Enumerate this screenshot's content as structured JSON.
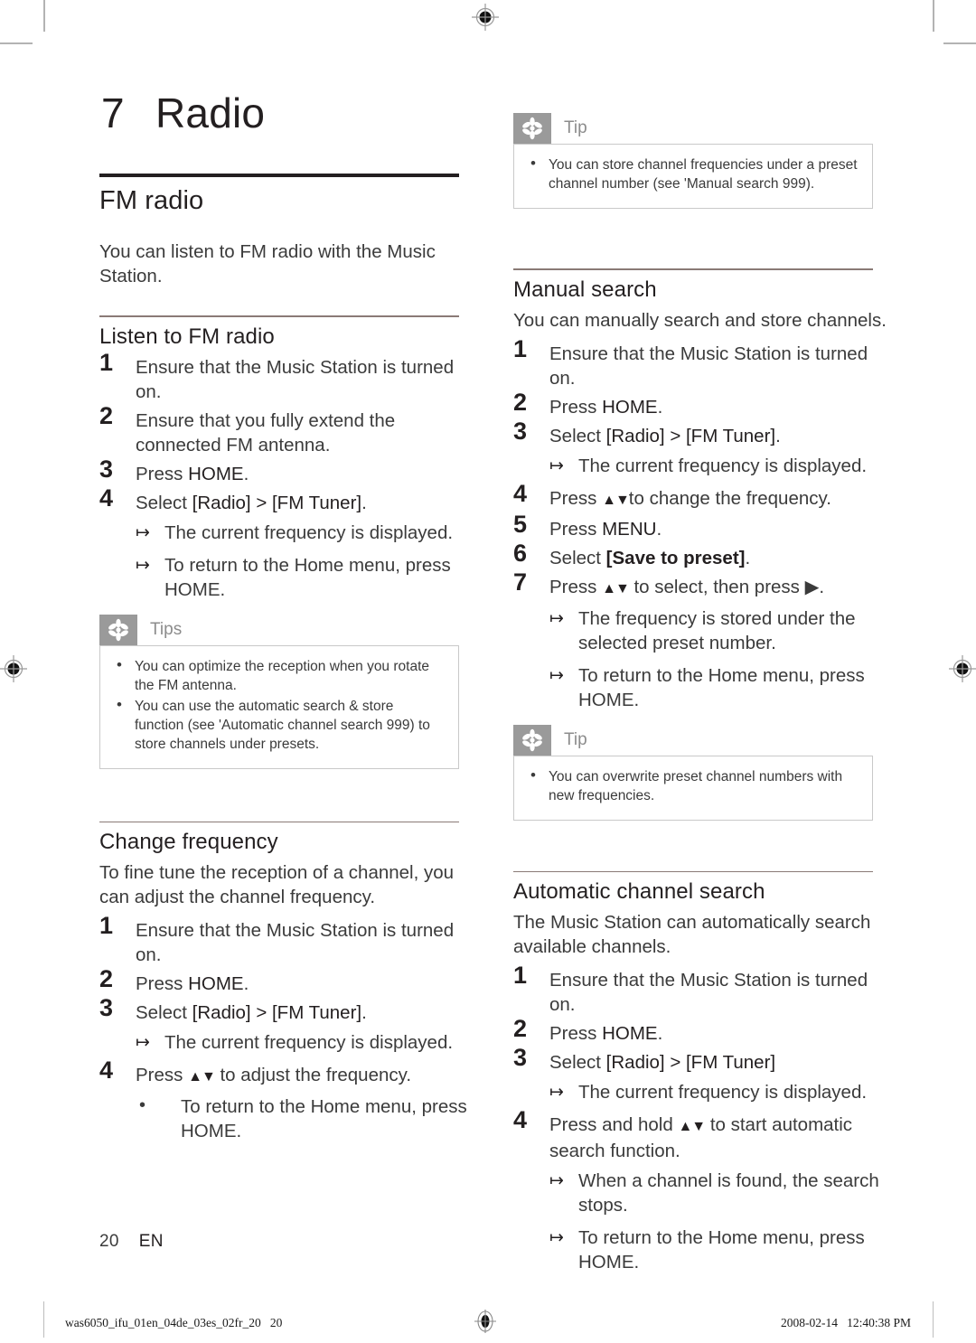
{
  "chapter": {
    "number": "7",
    "title": "Radio"
  },
  "section": {
    "title": "FM radio",
    "intro": "You can listen to FM radio with the Music Station."
  },
  "left_column": {
    "listen": {
      "heading": "Listen to FM radio",
      "steps": [
        {
          "text": "Ensure that the Music Station is turned on."
        },
        {
          "text": "Ensure that you fully extend the connected FM antenna."
        },
        {
          "text_pre": "Press ",
          "keyword": "HOME",
          "text_post": "."
        },
        {
          "text_pre": "Select ",
          "keyword": "[Radio] > [FM Tuner]",
          "text_post": ".",
          "results": [
            "The current frequency is displayed.",
            "To return to the Home menu, press HOME."
          ]
        }
      ]
    },
    "tips_box": {
      "label": "Tips",
      "icon": "asterisk-flower-icon",
      "items": [
        "You can optimize the reception when you rotate the FM antenna.",
        "You can use the automatic search & store function (see 'Automatic channel search 999) to store channels under presets."
      ]
    },
    "change_frequency": {
      "heading": "Change frequency",
      "intro": "To fine tune the reception of a channel, you can adjust the channel frequency.",
      "steps": [
        {
          "text": "Ensure that the Music Station is turned on."
        },
        {
          "text_pre": "Press ",
          "keyword": "HOME",
          "text_post": "."
        },
        {
          "text_pre": "Select ",
          "keyword": "[Radio] > [FM Tuner]",
          "text_post": ".",
          "results": [
            "The current frequency is displayed."
          ]
        },
        {
          "text_pre": "Press ",
          "arrows": "▲▼",
          "text_post": " to adjust the frequency.",
          "dots": [
            "To return to the Home menu, press HOME."
          ]
        }
      ]
    }
  },
  "right_column": {
    "tip_box_1": {
      "label": "Tip",
      "icon": "asterisk-flower-icon",
      "items": [
        "You can store channel frequencies under a preset channel number (see 'Manual search 999)."
      ]
    },
    "manual_search": {
      "heading": "Manual search",
      "intro": "You can manually search and store channels.",
      "steps": [
        {
          "text": "Ensure that the Music Station is turned on."
        },
        {
          "text_pre": "Press ",
          "keyword": "HOME",
          "text_post": "."
        },
        {
          "text_pre": "Select ",
          "keyword": "[Radio] > [FM Tuner]",
          "text_post": ".",
          "results": [
            "The current frequency is displayed."
          ]
        },
        {
          "text_pre": "Press ",
          "arrows": "▲▼",
          "text_post": "to change the frequency."
        },
        {
          "text_pre": "Press ",
          "keyword": "MENU",
          "text_post": "."
        },
        {
          "text_pre": "Select ",
          "keyword": "[Save to preset]",
          "text_post": "."
        },
        {
          "text_pre": "Press ",
          "arrows": "▲▼",
          "text_post": " to select, then press ▶.",
          "results": [
            "The frequency is stored under the selected preset number.",
            "To return to the Home menu, press HOME."
          ]
        }
      ]
    },
    "tip_box_2": {
      "label": "Tip",
      "icon": "asterisk-flower-icon",
      "items": [
        "You can overwrite preset channel numbers with new frequencies."
      ]
    },
    "auto_search": {
      "heading": "Automatic channel search",
      "intro": "The Music Station can automatically search available channels.",
      "steps": [
        {
          "text": "Ensure that the Music Station is turned on."
        },
        {
          "text_pre": "Press ",
          "keyword": "HOME",
          "text_post": "."
        },
        {
          "text_pre": "Select ",
          "keyword": "[Radio] > [FM Tuner]",
          "text_post": "",
          "results": [
            "The current frequency is displayed."
          ]
        },
        {
          "text_pre": "Press and hold ",
          "arrows": "▲▼",
          "text_post": " to start automatic search function.",
          "results": [
            "When a channel is found, the search stops.",
            "To return to the Home menu, press HOME."
          ]
        }
      ]
    }
  },
  "footer": {
    "page_number": "20",
    "language": "EN",
    "file_id": "was6050_ifu_01en_04de_03es_02fr_20   20",
    "timestamp": "2008-02-14   12:40:38 PM"
  }
}
